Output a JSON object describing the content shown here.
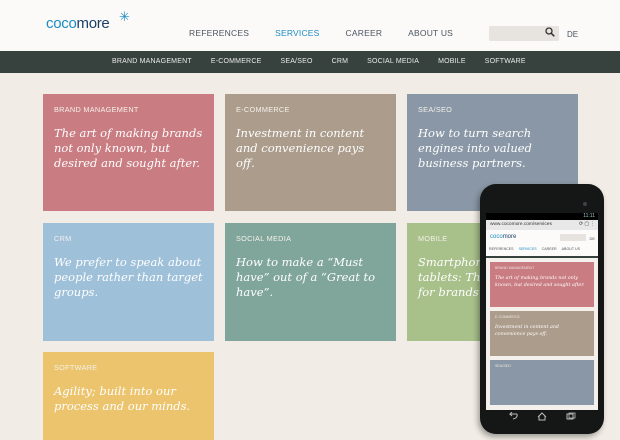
{
  "header": {
    "logo_part1": "coco",
    "logo_part2": "more",
    "nav": [
      "REFERENCES",
      "SERVICES",
      "CAREER",
      "ABOUT US"
    ],
    "active_nav": "SERVICES",
    "search_placeholder": "",
    "language": "DE"
  },
  "subnav": [
    "BRAND MANAGEMENT",
    "E-COMMERCE",
    "SEA/SEO",
    "CRM",
    "SOCIAL MEDIA",
    "MOBILE",
    "SOFTWARE"
  ],
  "tiles": [
    {
      "heading": "BRAND MANAGEMENT",
      "text": "The art of making brands not only known, but desired and sought after.",
      "color": "#c97c81"
    },
    {
      "heading": "E-COMMERCE",
      "text": "Investment in content and convenience pays off.",
      "color": "#ab9c8b"
    },
    {
      "heading": "SEA/SEO",
      "text": "How to turn search engines into valued business partners.",
      "color": "#8997a6"
    },
    {
      "heading": "CRM",
      "text": "We prefer to speak about people rather than target groups.",
      "color": "#9ec0d9"
    },
    {
      "heading": "SOCIAL MEDIA",
      "text": "How to make a “Must have” out of a “Great to have”.",
      "color": "#80a69c"
    },
    {
      "heading": "MOBILE",
      "text": "Smartphones and tablets: The new home for brands and stores.",
      "color": "#a8c08a"
    },
    {
      "heading": "SOFTWARE",
      "text": "Agility; built into our process and our minds.",
      "color": "#ebc46d"
    }
  ],
  "phone": {
    "status": "11:11",
    "url": "www.cocomore.com/services",
    "logo_part1": "coco",
    "logo_part2": "more",
    "nav": [
      "REFERENCES",
      "SERVICES",
      "CAREER",
      "ABOUT US"
    ],
    "active_nav": "SERVICES",
    "language": "DE",
    "tiles": [
      {
        "heading": "BRAND MANAGEMENT",
        "text": "The art of making brands not only known, but desired and sought after.",
        "color": "#c97c81"
      },
      {
        "heading": "E-COMMERCE",
        "text": "Investment in content and convenience pays off.",
        "color": "#ab9c8b"
      },
      {
        "heading": "SEA/SEO",
        "text": "",
        "color": "#8997a6"
      }
    ]
  },
  "colors": {
    "brand_blue": "#1b8cc4",
    "brand_navy": "#1b3f6a",
    "subnav_bg": "#37413e",
    "page_bg": "#f1ece5"
  }
}
